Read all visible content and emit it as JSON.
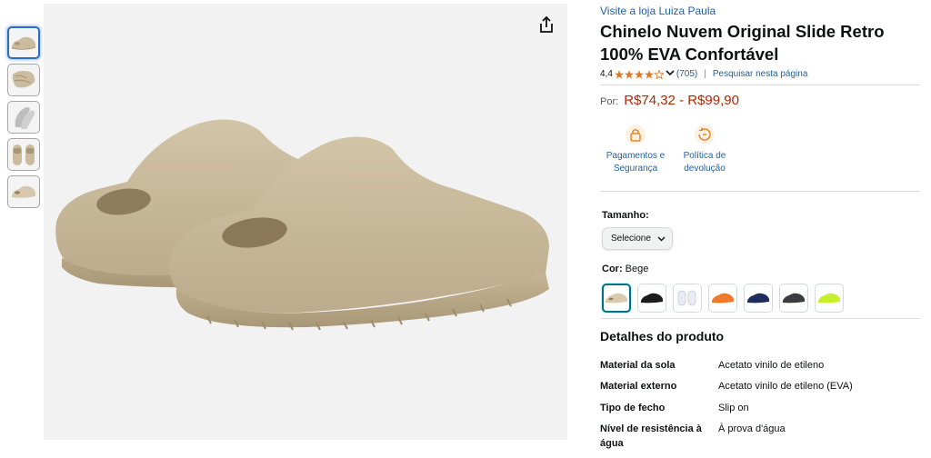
{
  "gallery": {
    "thumbnails": [
      {
        "alt": "Chinelo bege vista lateral"
      },
      {
        "alt": "Chinelo bege vista superior"
      },
      {
        "alt": "Chinelo com solado"
      },
      {
        "alt": "Par de chinelos vista frontal"
      },
      {
        "alt": "Chinelo bege vista lateral 2"
      }
    ],
    "share_icon": "share-icon"
  },
  "product": {
    "store_link": "Visite a loja Luiza Paula",
    "title": "Chinelo Nuvem Original Slide Retro 100% EVA Confortável",
    "rating_value": "4,4",
    "rating_stars": 4.4,
    "rating_count": "(705)",
    "search_page": "Pesquisar nesta página",
    "price_label": "Por:",
    "price_range": "R$74,32 - R$99,90"
  },
  "benefits": [
    {
      "icon": "lock-card-icon",
      "line1": "Pagamentos e",
      "line2": "Segurança"
    },
    {
      "icon": "return-policy-icon",
      "line1": "Política de",
      "line2": "devolução"
    }
  ],
  "size": {
    "label": "Tamanho:",
    "select_value": "Selecione"
  },
  "color": {
    "label": "Cor:",
    "selected": "Bege",
    "swatches": [
      {
        "name": "Bege",
        "hex": "#d9c9ae"
      },
      {
        "name": "Preto",
        "hex": "#1c1c1c"
      },
      {
        "name": "Branco",
        "hex": "#e9edf1"
      },
      {
        "name": "Laranja",
        "hex": "#f07a2a"
      },
      {
        "name": "Azul marinho",
        "hex": "#1f2d5c"
      },
      {
        "name": "Cinza escuro",
        "hex": "#3a3d3f"
      },
      {
        "name": "Verde limão",
        "hex": "#c8f02a"
      }
    ]
  },
  "details": {
    "title": "Detalhes do produto",
    "rows": [
      {
        "key": "Material da sola",
        "value": "Acetato vinilo de etileno"
      },
      {
        "key": "Material externo",
        "value": "Acetato vinilo de etileno (EVA)"
      },
      {
        "key": "Tipo de fecho",
        "value": "Slip on"
      },
      {
        "key": "Nível de resistência à água",
        "value": "À prova d'água"
      }
    ]
  },
  "colors": {
    "link": "#2162a1",
    "price": "#b12704",
    "star": "#de7921",
    "product": "#cbbc9f"
  }
}
